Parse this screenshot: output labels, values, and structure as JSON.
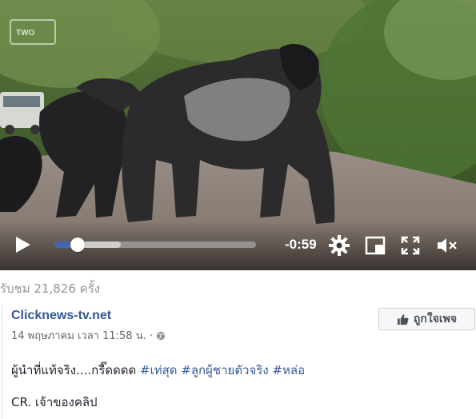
{
  "video": {
    "channel_logo": "TWO",
    "progress_fraction": 0.09,
    "buffered_fraction": 0.33,
    "time_remaining": "-0:59",
    "icons": [
      "play-icon",
      "settings-gear-icon",
      "picture-in-picture-icon",
      "fullscreen-icon",
      "mute-icon"
    ],
    "accent_color": "#4267b2"
  },
  "views_text": "รับชม 21,826 ครั้ง",
  "post": {
    "page_name": "Clicknews-tv.net",
    "timestamp": "14 พฤษภาคม เวลา 11:58 น.",
    "separator": "·",
    "privacy_icon": "globe-icon",
    "like_button_label": "ถูกใจเพจ",
    "caption_text": "ผู้นำที่แท้จริง....กรี๊ดดดด ",
    "hashtags": [
      "#เท่สุด",
      "#ลูกผู้ชายตัวจริง",
      "#หล่อ"
    ],
    "credit": "CR. เจ้าของคลิป",
    "link_color": "#365899"
  }
}
